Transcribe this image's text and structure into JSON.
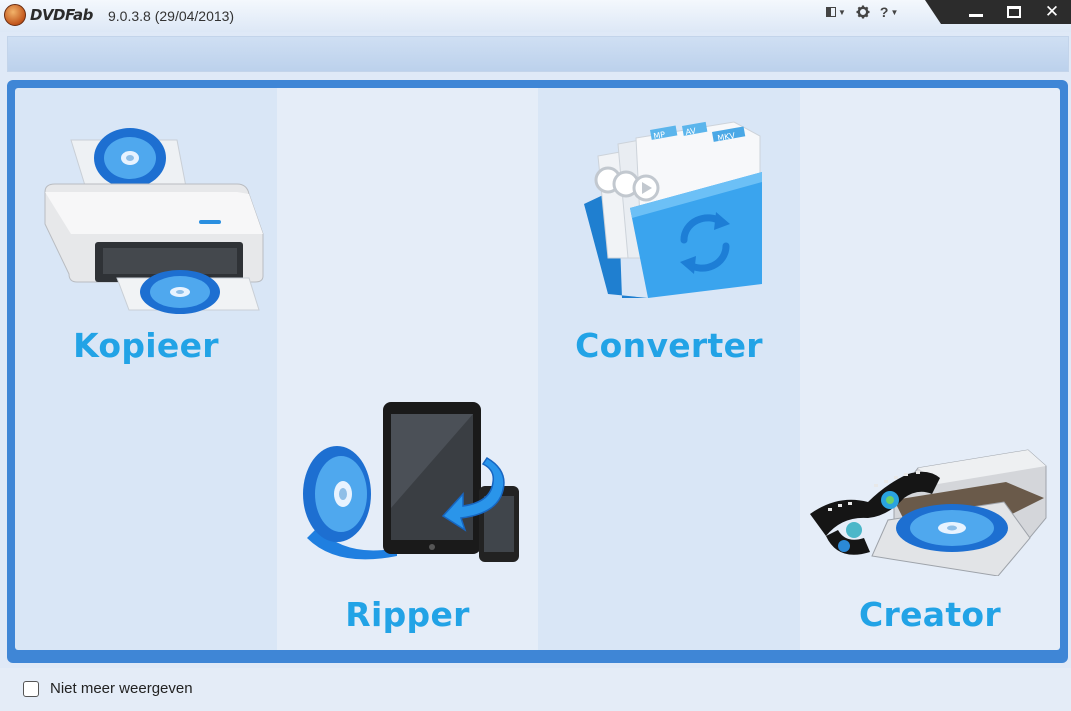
{
  "app": {
    "logo_text": "DVDFab",
    "version": "9.0.3.8 (29/04/2013)"
  },
  "toolbar": {
    "layout_icon": "layout-icon",
    "settings_icon": "gear-icon",
    "help_label": "?",
    "help_icon": "help-icon"
  },
  "window": {
    "minimize_icon": "minimize-icon",
    "maximize_icon": "maximize-icon",
    "close_label": "✕"
  },
  "panels": [
    {
      "label": "Kopieer",
      "icon": "printer-disc-icon"
    },
    {
      "label": "Ripper",
      "icon": "tablet-disc-icon"
    },
    {
      "label": "Converter",
      "icon": "folder-convert-icon"
    },
    {
      "label": "Creator",
      "icon": "film-disc-drive-icon"
    }
  ],
  "converter_tags": [
    "MP",
    "AV",
    "MKV"
  ],
  "footer": {
    "dont_show_label": "Niet meer weergeven",
    "dont_show_checked": false
  },
  "colors": {
    "accent": "#22a3e6",
    "frame": "#3f86d6",
    "panel_dark": "#d9e6f6",
    "panel_light": "#e5edf8"
  }
}
